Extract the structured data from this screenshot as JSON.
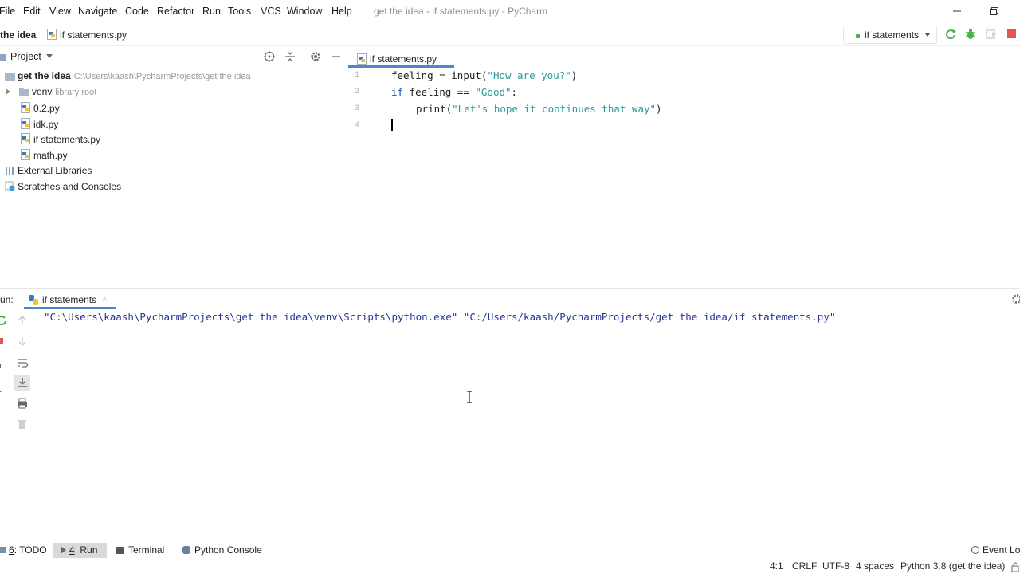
{
  "menu": {
    "file": "File",
    "edit": "Edit",
    "view": "View",
    "navigate": "Navigate",
    "code": "Code",
    "refactor": "Refactor",
    "run": "Run",
    "tools": "Tools",
    "vcs": "VCS",
    "window": "Window",
    "help": "Help"
  },
  "window_title": "get the idea - if statements.py - PyCharm",
  "navbar": {
    "project": "the idea",
    "file": "if statements.py",
    "run_config": "if statements"
  },
  "project_panel": {
    "title": "Project",
    "tree": [
      {
        "label": "get the idea",
        "hint": "C:\\Users\\kaash\\PycharmProjects\\get the idea"
      },
      {
        "label": "venv",
        "hint": "library root"
      },
      {
        "label": "0.2.py",
        "hint": ""
      },
      {
        "label": "idk.py",
        "hint": ""
      },
      {
        "label": "if statements.py",
        "hint": ""
      },
      {
        "label": "math.py",
        "hint": ""
      },
      {
        "label": "External Libraries",
        "hint": ""
      },
      {
        "label": "Scratches and Consoles",
        "hint": ""
      }
    ]
  },
  "editor": {
    "tab": "if statements.py",
    "line_numbers": [
      "1",
      "2",
      "3",
      "4"
    ],
    "code": {
      "l1_var": "feeling",
      "l1_op": " = ",
      "l1_fn": "input(",
      "l1_str": "\"How are you?\"",
      "l1_end": ")",
      "l2_kw": "if",
      "l2_mid": " feeling == ",
      "l2_str": "\"Good\"",
      "l2_end": ":",
      "l3_fn": "print(",
      "l3_str": "\"Let's hope it continues that way\"",
      "l3_end": ")"
    }
  },
  "run_panel": {
    "label": "un:",
    "tab": "if statements",
    "console": "\"C:\\Users\\kaash\\PycharmProjects\\get the idea\\venv\\Scripts\\python.exe\" \"C:/Users/kaash/PycharmProjects/get the idea/if statements.py\""
  },
  "bottom_tabs": {
    "todo_num": "6",
    "todo": ": TODO",
    "run_num": "4",
    "run": ": Run",
    "terminal": "Terminal",
    "python_console": "Python Console",
    "event_log": "Event Lo"
  },
  "status": {
    "position": "4:1",
    "line_sep": "CRLF",
    "encoding": "UTF-8",
    "indent": "4 spaces",
    "interpreter": "Python 3.8 (get the idea)"
  },
  "colors": {
    "accent": "#4a88c7",
    "run_green": "#4caf50",
    "stop_red": "#e05555",
    "keyword": "#1f4eb0",
    "string": "#2a9a9a"
  }
}
